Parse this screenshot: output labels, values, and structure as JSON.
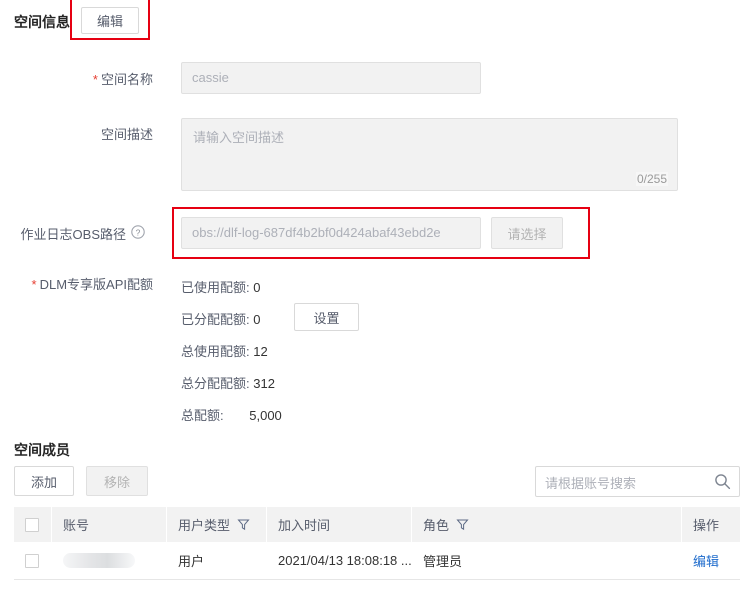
{
  "space_info": {
    "title": "空间信息",
    "edit_button": "编辑",
    "fields": {
      "space_name": {
        "label": "空间名称",
        "required": true,
        "value": "cassie"
      },
      "space_desc": {
        "label": "空间描述",
        "required": false,
        "placeholder": "请输入空间描述",
        "counter": "0/255"
      },
      "obs_path": {
        "label": "作业日志OBS路径",
        "required": false,
        "help_icon": "help-circle-icon",
        "value": "obs://dlf-log-687df4b2bf0d424abaf43ebd2e",
        "select_button": "请选择"
      },
      "dlm_quota": {
        "label": "DLM专享版API配额",
        "required": true,
        "set_button": "设置",
        "rows": [
          {
            "label": "已使用配额:",
            "value": "0"
          },
          {
            "label": "已分配配额:",
            "value": "0"
          },
          {
            "label": "总使用配额:",
            "value": "12"
          },
          {
            "label": "总分配配额:",
            "value": "312"
          },
          {
            "label": "总配额:",
            "value": "5,000"
          }
        ]
      }
    }
  },
  "space_members": {
    "title": "空间成员",
    "toolbar": {
      "add_button": "添加",
      "remove_button": "移除",
      "remove_disabled": true,
      "search_placeholder": "请根据账号搜索",
      "search_icon": "search-icon"
    },
    "table": {
      "columns": [
        {
          "key": "check",
          "label": ""
        },
        {
          "key": "account",
          "label": "账号"
        },
        {
          "key": "user_type",
          "label": "用户类型",
          "filter_icon": "filter-icon"
        },
        {
          "key": "join_time",
          "label": "加入时间"
        },
        {
          "key": "role",
          "label": "角色",
          "filter_icon": "filter-icon"
        },
        {
          "key": "operation",
          "label": "操作"
        }
      ],
      "rows": [
        {
          "account": "",
          "account_redacted": true,
          "user_type": "用户",
          "join_time": "2021/04/13 18:08:18 ...",
          "role": "管理员",
          "operation": "编辑"
        }
      ]
    }
  },
  "annotations": {
    "color": "#e60012",
    "boxes": [
      "edit-button-highlight",
      "obs-path-row-highlight"
    ]
  }
}
